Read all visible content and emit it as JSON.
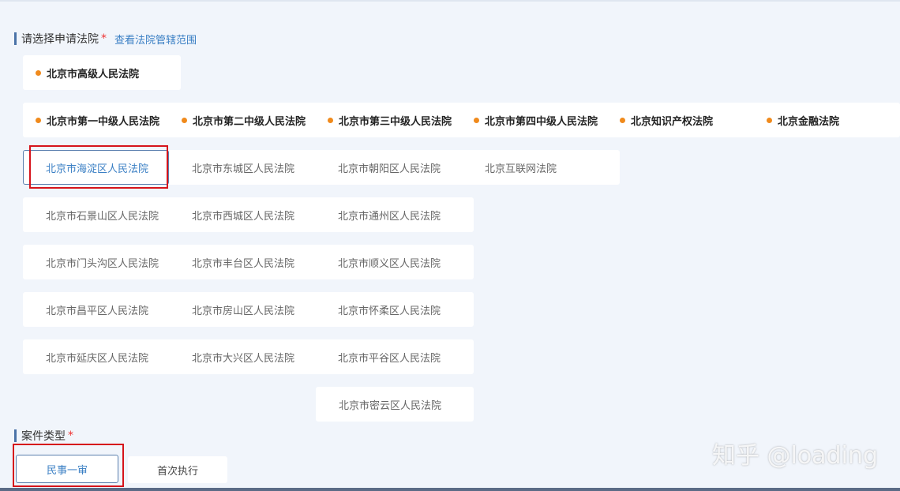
{
  "court_section": {
    "title": "请选择申请法院",
    "required_mark": "*",
    "view_scope_link": "查看法院管辖范围"
  },
  "high_court": {
    "label": "北京市高级人民法院"
  },
  "intermediate_courts": [
    "北京市第一中级人民法院",
    "北京市第二中级人民法院",
    "北京市第三中级人民法院",
    "北京市第四中级人民法院",
    "北京知识产权法院",
    "北京金融法院"
  ],
  "district_rows": [
    [
      "北京市海淀区人民法院",
      "北京市东城区人民法院",
      "北京市朝阳区人民法院",
      "北京互联网法院"
    ],
    [
      "北京市石景山区人民法院",
      "北京市西城区人民法院",
      "北京市通州区人民法院"
    ],
    [
      "北京市门头沟区人民法院",
      "北京市丰台区人民法院",
      "北京市顺义区人民法院"
    ],
    [
      "北京市昌平区人民法院",
      "北京市房山区人民法院",
      "北京市怀柔区人民法院"
    ],
    [
      "北京市延庆区人民法院",
      "北京市大兴区人民法院",
      "北京市平谷区人民法院"
    ],
    [
      "北京市密云区人民法院"
    ]
  ],
  "selected_court": "北京市海淀区人民法院",
  "case_section": {
    "title": "案件类型",
    "required_mark": "*",
    "options": [
      "民事一审",
      "首次执行"
    ],
    "selected": "民事一审"
  },
  "watermark": "知乎 @loading",
  "colors": {
    "accent": "#3a7fc4",
    "dot": "#f08a1c",
    "highlight_box": "#d6141b",
    "section_bar": "#4b73a8"
  }
}
